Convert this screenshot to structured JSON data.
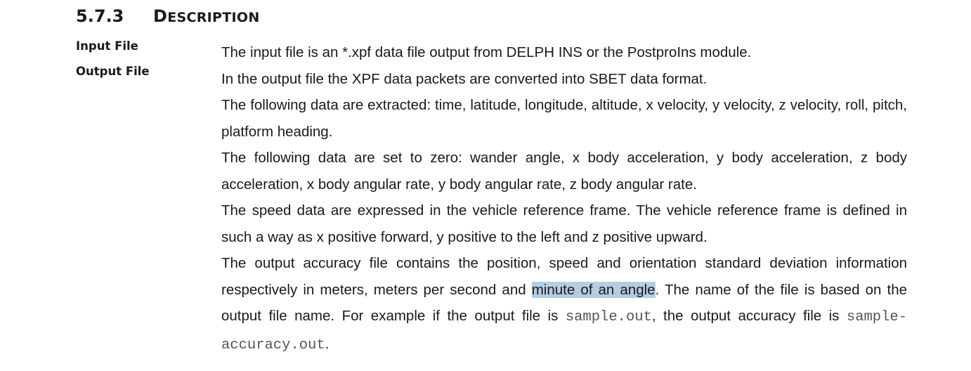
{
  "section": {
    "number": "5.7.3",
    "title_initial": "D",
    "title_rest": "ESCRIPTION"
  },
  "labels": {
    "input": "Input File",
    "output": "Output File"
  },
  "paragraphs": {
    "p1": "The input file is an *.xpf data file output from DELPH INS or the PostproIns module.",
    "p2": "In the output file the XPF data packets are converted into SBET data format.",
    "p3": "The following data are extracted: time, latitude, longitude, altitude, x velocity, y velocity, z velocity, roll, pitch, platform heading.",
    "p4": "The following data are set to zero: wander angle, x body acceleration, y body acceleration, z body acceleration, x body angular rate, y body angular rate, z body angular rate.",
    "p5": "The speed data are expressed in the vehicle reference frame. The vehicle reference frame is defined in such a way as x positive forward, y positive to the left and z positive upward.",
    "p6": {
      "part1": "The output accuracy file contains the position, speed and orientation standard deviation information respectively in meters, meters per second and ",
      "highlight": "minute of an angle",
      "part2": ". The name of the file is based on the output file name. For example if the output file is ",
      "code1": "sample.out",
      "part3": ", the output accuracy file is ",
      "code2": "sample-accuracy.out",
      "part4": "."
    }
  },
  "colors": {
    "highlight": "#b4cde3",
    "code_text": "#555555"
  }
}
